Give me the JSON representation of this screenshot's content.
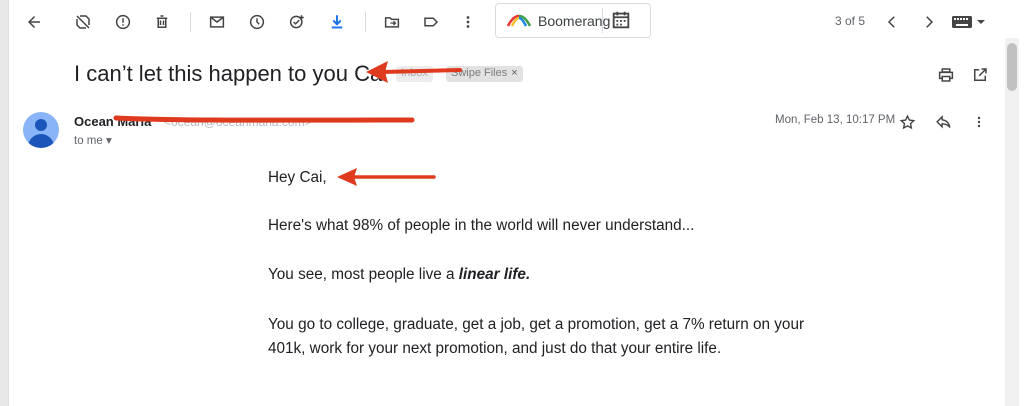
{
  "toolbar": {
    "icons": [
      "back-arrow-icon",
      "not-spam-icon",
      "report-icon",
      "delete-icon",
      "mark-unread-icon",
      "snooze-icon",
      "add-task-icon",
      "download-icon",
      "move-to-icon",
      "label-icon",
      "more-vert-icon"
    ],
    "boomerang_label": "Boomerang",
    "pager": "3 of 5"
  },
  "subject": {
    "text": "I can’t let this happen to you Cai",
    "labels": [
      {
        "name": "Inbox"
      },
      {
        "name": "Swipe Files",
        "removable": "×"
      }
    ]
  },
  "message": {
    "sender_name": "Ocean Maria",
    "sender_email": "<ocean@oceanmaria.com>",
    "recipient": "to me",
    "date": "Mon, Feb 13, 10:17 PM"
  },
  "body": {
    "greeting": "Hey Cai,",
    "p1": "Here's what 98% of people in the world will never understand...",
    "p2_prefix": "You see, most people live a ",
    "p2_emphasis": "linear life.",
    "p3": "You go to college, graduate, get a job, get a promotion, get a 7% return on your 401k, work for your next promotion, and just do that your entire life."
  },
  "colors": {
    "annotation_red": "#e03a1e",
    "download_accent": "#1a73e8",
    "avatar_bg": "#8ab4f8",
    "avatar_fg": "#1a56b9"
  }
}
